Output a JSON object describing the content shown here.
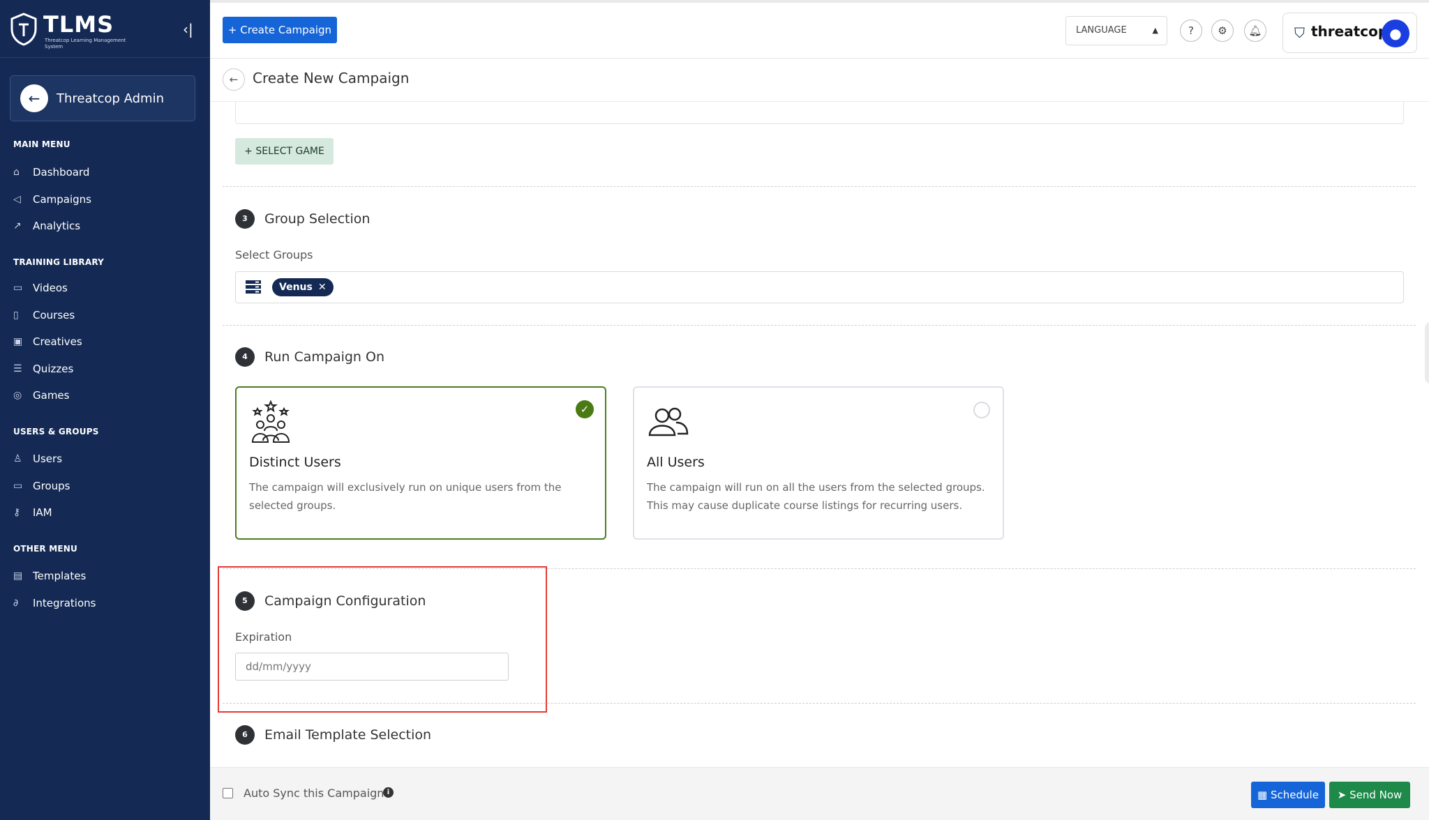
{
  "brand": {
    "name": "TLMS",
    "subtitle": "Threatcop Learning Management System"
  },
  "admin": {
    "name": "Threatcop Admin"
  },
  "sidebar": {
    "sections": [
      {
        "title": "MAIN MENU",
        "items": [
          {
            "label": "Dashboard",
            "icon": "home-icon"
          },
          {
            "label": "Campaigns",
            "icon": "megaphone-icon"
          },
          {
            "label": "Analytics",
            "icon": "chart-line-icon"
          }
        ]
      },
      {
        "title": "TRAINING LIBRARY",
        "items": [
          {
            "label": "Videos",
            "icon": "video-icon"
          },
          {
            "label": "Courses",
            "icon": "book-icon"
          },
          {
            "label": "Creatives",
            "icon": "image-icon"
          },
          {
            "label": "Quizzes",
            "icon": "list-icon"
          },
          {
            "label": "Games",
            "icon": "gamepad-icon"
          }
        ]
      },
      {
        "title": "USERS & GROUPS",
        "items": [
          {
            "label": "Users",
            "icon": "user-icon"
          },
          {
            "label": "Groups",
            "icon": "folder-icon"
          },
          {
            "label": "IAM",
            "icon": "key-icon"
          }
        ]
      },
      {
        "title": "OTHER MENU",
        "items": [
          {
            "label": "Templates",
            "icon": "template-icon"
          },
          {
            "label": "Integrations",
            "icon": "link-icon"
          }
        ]
      }
    ]
  },
  "topbar": {
    "create_label": "+ Create Campaign",
    "language_label": "LANGUAGE",
    "org_name": "threatcop"
  },
  "subheader": {
    "title": "Create New Campaign"
  },
  "main": {
    "select_game_label": "+ SELECT GAME",
    "step3": {
      "num": "3",
      "title": "Group Selection",
      "field_label": "Select Groups",
      "chips": [
        "Venus"
      ]
    },
    "step4": {
      "num": "4",
      "title": "Run Campaign On",
      "options": [
        {
          "title": "Distinct Users",
          "desc": "The campaign will exclusively run on unique users from the selected groups.",
          "selected": true
        },
        {
          "title": "All Users",
          "desc": "The campaign will run on all the users from the selected groups. This may cause duplicate course listings for recurring users.",
          "selected": false
        }
      ]
    },
    "step5": {
      "num": "5",
      "title": "Campaign Configuration",
      "field_label": "Expiration",
      "placeholder": "dd/mm/yyyy"
    },
    "step6": {
      "num": "6",
      "title": "Email Template Selection"
    }
  },
  "footer": {
    "auto_sync_label": "Auto Sync this Campaign",
    "schedule_label": "Schedule",
    "send_now_label": "Send Now"
  },
  "colors": {
    "sidebar": "#142a55",
    "primary": "#1565d8",
    "success": "#1e8a4a",
    "selected_border": "#4b7d1d",
    "highlight": "#e53935"
  }
}
